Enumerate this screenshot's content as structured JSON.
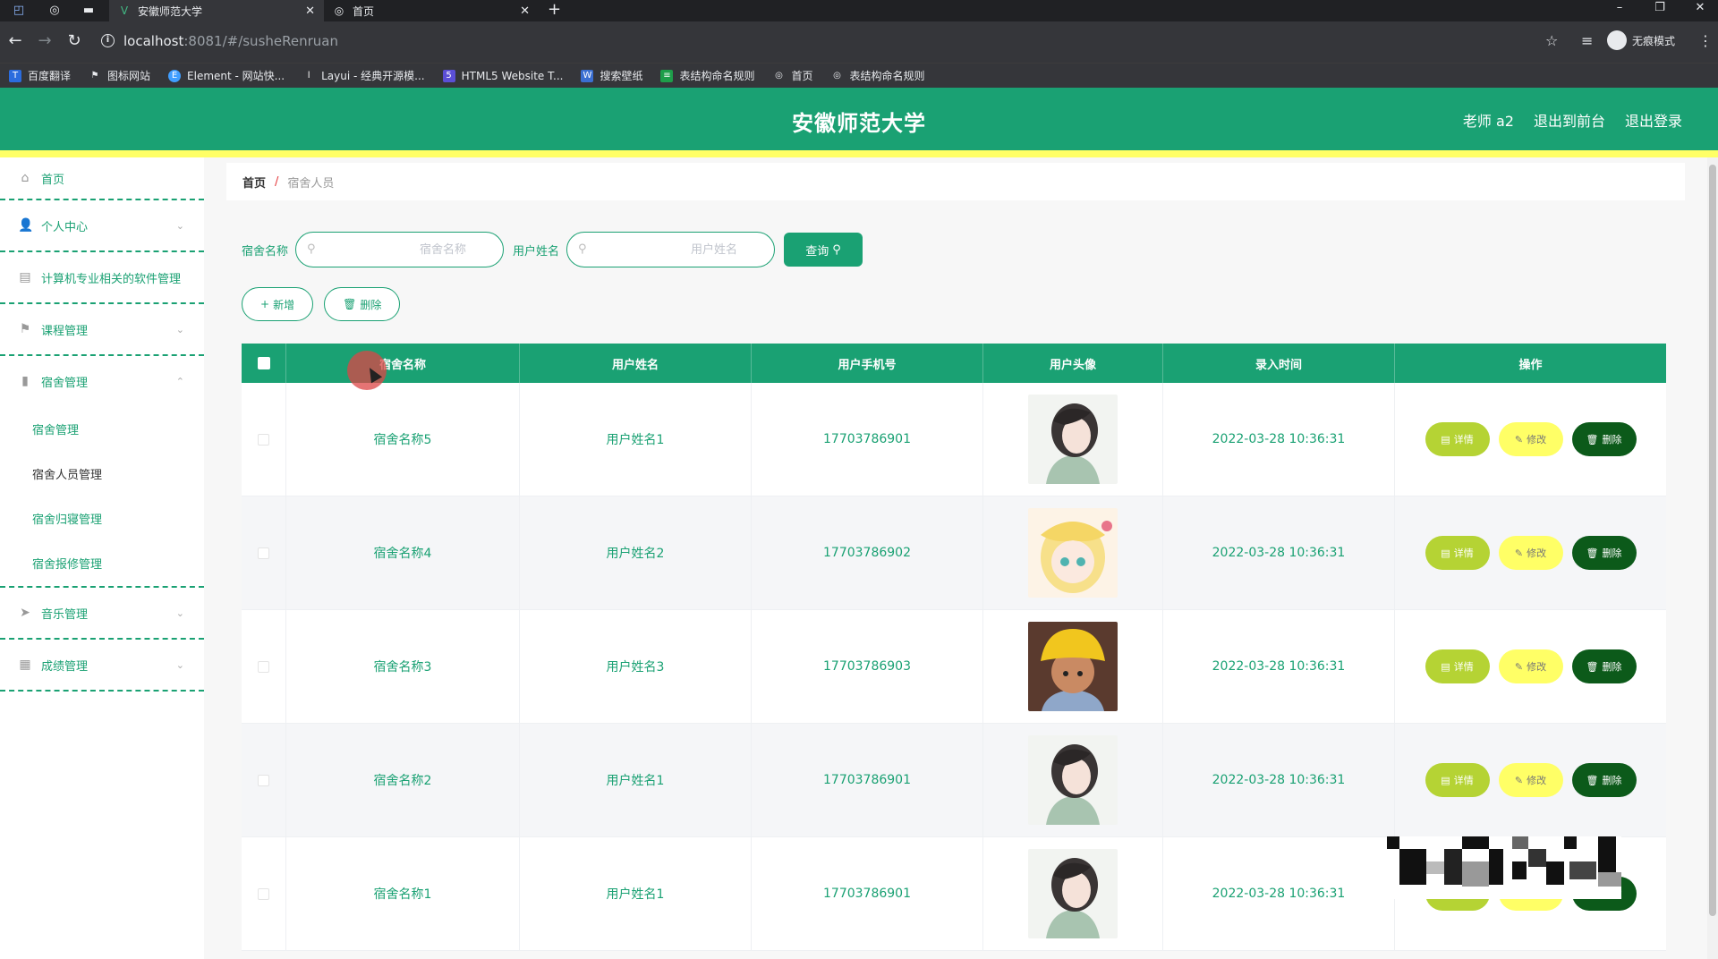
{
  "browser": {
    "tabs": [
      {
        "title": "安徽师范大学",
        "active": true
      },
      {
        "title": "首页",
        "active": false
      }
    ],
    "url_host": "localhost",
    "url_rest": ":8081/#/susheRenruan",
    "incognito_label": "无痕模式",
    "bookmarks": [
      "百度翻译",
      "图标网站",
      "Element - 网站快...",
      "Layui - 经典开源模...",
      "HTML5 Website T...",
      "搜索壁纸",
      "表结构命名规则",
      "首页",
      "表结构命名规则"
    ]
  },
  "header": {
    "title": "安徽师范大学",
    "user": "老师 a2",
    "back_front": "退出到前台",
    "logout": "退出登录"
  },
  "sidebar": {
    "items": [
      {
        "label": "首页",
        "icon": "home-icon"
      },
      {
        "label": "个人中心",
        "icon": "user-icon"
      },
      {
        "label": "计算机专业相关的软件管理",
        "icon": "briefcase-icon"
      },
      {
        "label": "课程管理",
        "icon": "flag-icon"
      },
      {
        "label": "宿舍管理",
        "icon": "bar-chart-icon"
      },
      {
        "label": "音乐管理",
        "icon": "send-icon"
      },
      {
        "label": "成绩管理",
        "icon": "grid-icon"
      }
    ],
    "subitems": [
      "宿舍管理",
      "宿舍人员管理",
      "宿舍归寝管理",
      "宿舍报修管理"
    ]
  },
  "breadcrumb": {
    "home": "首页",
    "separator": "/",
    "current": "宿舍人员"
  },
  "search": {
    "dorm_label": "宿舍名称",
    "dorm_placeholder": "宿舍名称",
    "user_label": "用户姓名",
    "user_placeholder": "用户姓名",
    "query_button": "查询"
  },
  "actions": {
    "add": "新增",
    "delete": "删除"
  },
  "table": {
    "columns": [
      "宿舍名称",
      "用户姓名",
      "用户手机号",
      "用户头像",
      "录入时间",
      "操作"
    ],
    "rows": [
      {
        "dorm": "宿舍名称5",
        "name": "用户姓名1",
        "phone": "17703786901",
        "time": "2022-03-28 10:36:31"
      },
      {
        "dorm": "宿舍名称4",
        "name": "用户姓名2",
        "phone": "17703786902",
        "time": "2022-03-28 10:36:31"
      },
      {
        "dorm": "宿舍名称3",
        "name": "用户姓名3",
        "phone": "17703786903",
        "time": "2022-03-28 10:36:31"
      },
      {
        "dorm": "宿舍名称2",
        "name": "用户姓名1",
        "phone": "17703786901",
        "time": "2022-03-28 10:36:31"
      },
      {
        "dorm": "宿舍名称1",
        "name": "用户姓名1",
        "phone": "17703786901",
        "time": "2022-03-28 10:36:31"
      }
    ],
    "op_detail": "详情",
    "op_edit": "修改",
    "op_delete": "删除"
  },
  "colors": {
    "primary": "#1aa173",
    "accent_yellow": "#ffff66",
    "detail_green": "#b5d334",
    "delete_dark": "#0c5a1a"
  }
}
